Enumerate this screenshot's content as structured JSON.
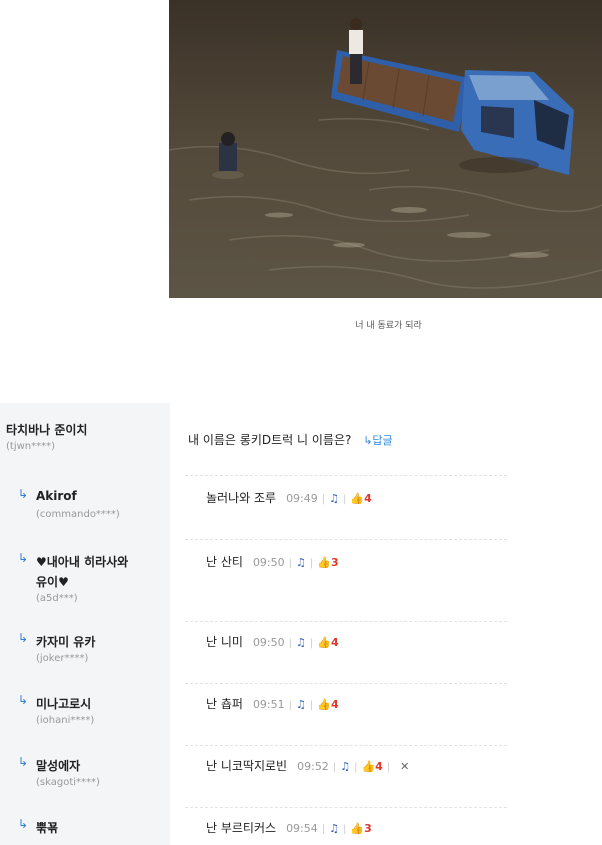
{
  "caption": "너 내 동료가 되라",
  "top_comment": {
    "author": "타치바나 준이치",
    "uid": "(tjwn****)",
    "text": "내 이름은 롱키D트럭 니 이름은?",
    "reply_label": "답글",
    "reply_icon": "reply-arrow-icon"
  },
  "replies": [
    {
      "author": "Akirof",
      "uid": "(commando****)",
      "text": "놀러나와 조루",
      "time": "09:49",
      "likes": "4"
    },
    {
      "author": "♥내아내 히라사와",
      "author2": "유이♥",
      "uid": "(a5d***)",
      "text": "난 산티",
      "time": "09:50",
      "likes": "3"
    },
    {
      "author": "카자미 유카",
      "uid": "(joker****)",
      "text": "난 니미",
      "time": "09:50",
      "likes": "4"
    },
    {
      "author": "미나고로시",
      "uid": "(iohani****)",
      "text": "난 춉퍼",
      "time": "09:51",
      "likes": "4"
    },
    {
      "author": "말성에자",
      "uid": "(skagoti****)",
      "text": "난 니코딱지로빈",
      "time": "09:52",
      "likes": "4"
    },
    {
      "author": "뿎꾞",
      "uid": "",
      "text": "난 부르티커스",
      "time": "09:54",
      "likes": "3"
    }
  ],
  "colors": {
    "like_count": "#e0382b",
    "reply_link": "#2f8ae0",
    "left_bg": "#f4f5f7"
  }
}
